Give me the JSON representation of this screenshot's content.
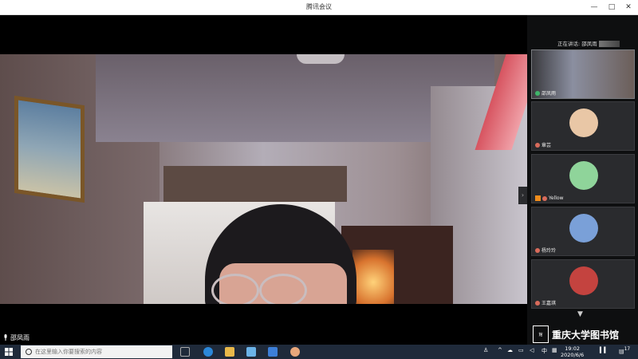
{
  "window": {
    "title": "腾讯会议",
    "minimize": "—",
    "maximize": "□",
    "close": "✕"
  },
  "stage": {
    "speaker_label": "邵凤雨",
    "collapse_arrow": "›"
  },
  "panel": {
    "now_speaking": "正在讲话: 邵凤雨",
    "tiles": [
      {
        "name": "邵凤雨",
        "mic": "green",
        "type": "camera"
      },
      {
        "name": "章芸",
        "mic": "red",
        "type": "avatar",
        "avatar_color": "#e9c7a6"
      },
      {
        "name": "Yellow",
        "mic": "red",
        "type": "avatar",
        "avatar_color": "#8fd49a"
      },
      {
        "name": "杨玲玲",
        "mic": "red",
        "type": "avatar",
        "avatar_color": "#7aa0d8"
      },
      {
        "name": "王嘉琪",
        "mic": "red",
        "type": "avatar",
        "avatar_color": "#c4433f"
      }
    ],
    "more_arrow": "▼"
  },
  "watermark": {
    "text": "重庆大学图书馆",
    "seal_text": "館"
  },
  "taskbar": {
    "search_placeholder": "在这里输入你要搜索的内容",
    "tray_ime": "中",
    "clock_time": "19:02",
    "clock_date": "2020/6/6",
    "notification_count": "17"
  },
  "colors": {
    "accent_green": "#3fb56a",
    "mic_red": "#d96b5b",
    "taskbar": "#1f2a3a"
  }
}
